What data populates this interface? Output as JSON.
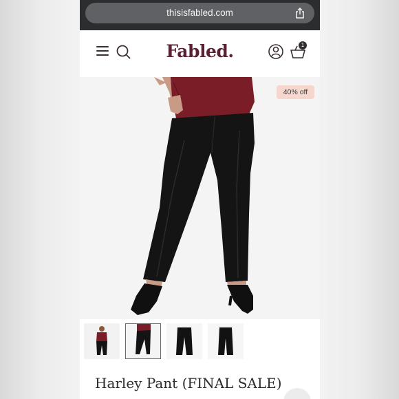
{
  "browser": {
    "url": "thisisfabled.com"
  },
  "header": {
    "logo": "Fabled.",
    "cart_count": "1"
  },
  "product": {
    "discount_badge": "40% off",
    "title": "Harley Pant (FINAL SALE)",
    "thumbnail_count": 4,
    "active_thumbnail": 2
  },
  "icons": {
    "menu": "hamburger-icon",
    "search": "search-icon",
    "account": "user-icon",
    "cart": "shopping-basket-icon",
    "share": "share-icon"
  },
  "colors": {
    "brand": "#5b1f36",
    "badge_bg": "#f5d7cd",
    "browser_chrome": "#2b2d2f"
  }
}
